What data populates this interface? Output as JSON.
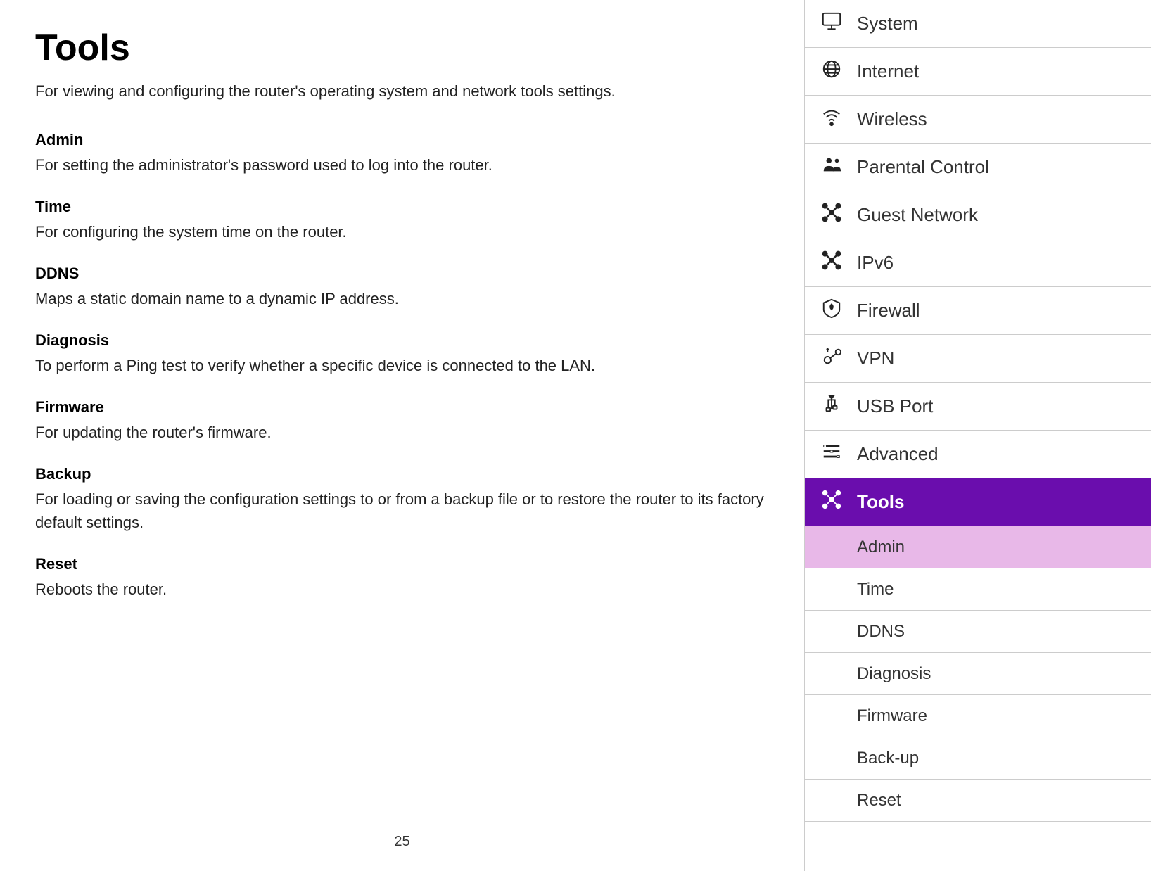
{
  "page": {
    "title": "Tools",
    "intro": "For viewing and configuring the router's operating system and network tools settings.",
    "page_number": "25"
  },
  "sections": [
    {
      "id": "admin",
      "title": "Admin",
      "desc": "For setting the administrator's password used to log into the router."
    },
    {
      "id": "time",
      "title": "Time",
      "desc": "For configuring the system time on the router."
    },
    {
      "id": "ddns",
      "title": "DDNS",
      "desc": "Maps a static domain name to a dynamic IP address."
    },
    {
      "id": "diagnosis",
      "title": "Diagnosis",
      "desc": "To perform a Ping test to verify whether a specific device is connected to the LAN."
    },
    {
      "id": "firmware",
      "title": "Firmware",
      "desc": "For updating the router's firmware."
    },
    {
      "id": "backup",
      "title": "Backup",
      "desc": "For loading or saving the configuration settings to or from a backup file or to restore the router to its factory default settings."
    },
    {
      "id": "reset",
      "title": "Reset",
      "desc": "Reboots the router."
    }
  ],
  "sidebar": {
    "items": [
      {
        "id": "system",
        "label": "System",
        "icon": "monitor"
      },
      {
        "id": "internet",
        "label": "Internet",
        "icon": "internet"
      },
      {
        "id": "wireless",
        "label": "Wireless",
        "icon": "wireless"
      },
      {
        "id": "parental",
        "label": "Parental Control",
        "icon": "parental"
      },
      {
        "id": "guest",
        "label": "Guest Network",
        "icon": "guest"
      },
      {
        "id": "ipv6",
        "label": "IPv6",
        "icon": "ipv6"
      },
      {
        "id": "firewall",
        "label": "Firewall",
        "icon": "firewall"
      },
      {
        "id": "vpn",
        "label": "VPN",
        "icon": "vpn"
      },
      {
        "id": "usb",
        "label": "USB Port",
        "icon": "usb"
      },
      {
        "id": "advanced",
        "label": "Advanced",
        "icon": "advanced"
      },
      {
        "id": "tools",
        "label": "Tools",
        "icon": "tools",
        "active": true
      }
    ],
    "subitems": [
      {
        "id": "admin",
        "label": "Admin",
        "active": true
      },
      {
        "id": "time",
        "label": "Time"
      },
      {
        "id": "ddns",
        "label": "DDNS"
      },
      {
        "id": "diagnosis",
        "label": "Diagnosis"
      },
      {
        "id": "firmware",
        "label": "Firmware"
      },
      {
        "id": "backup",
        "label": "Back-up"
      },
      {
        "id": "reset",
        "label": "Reset"
      }
    ]
  }
}
